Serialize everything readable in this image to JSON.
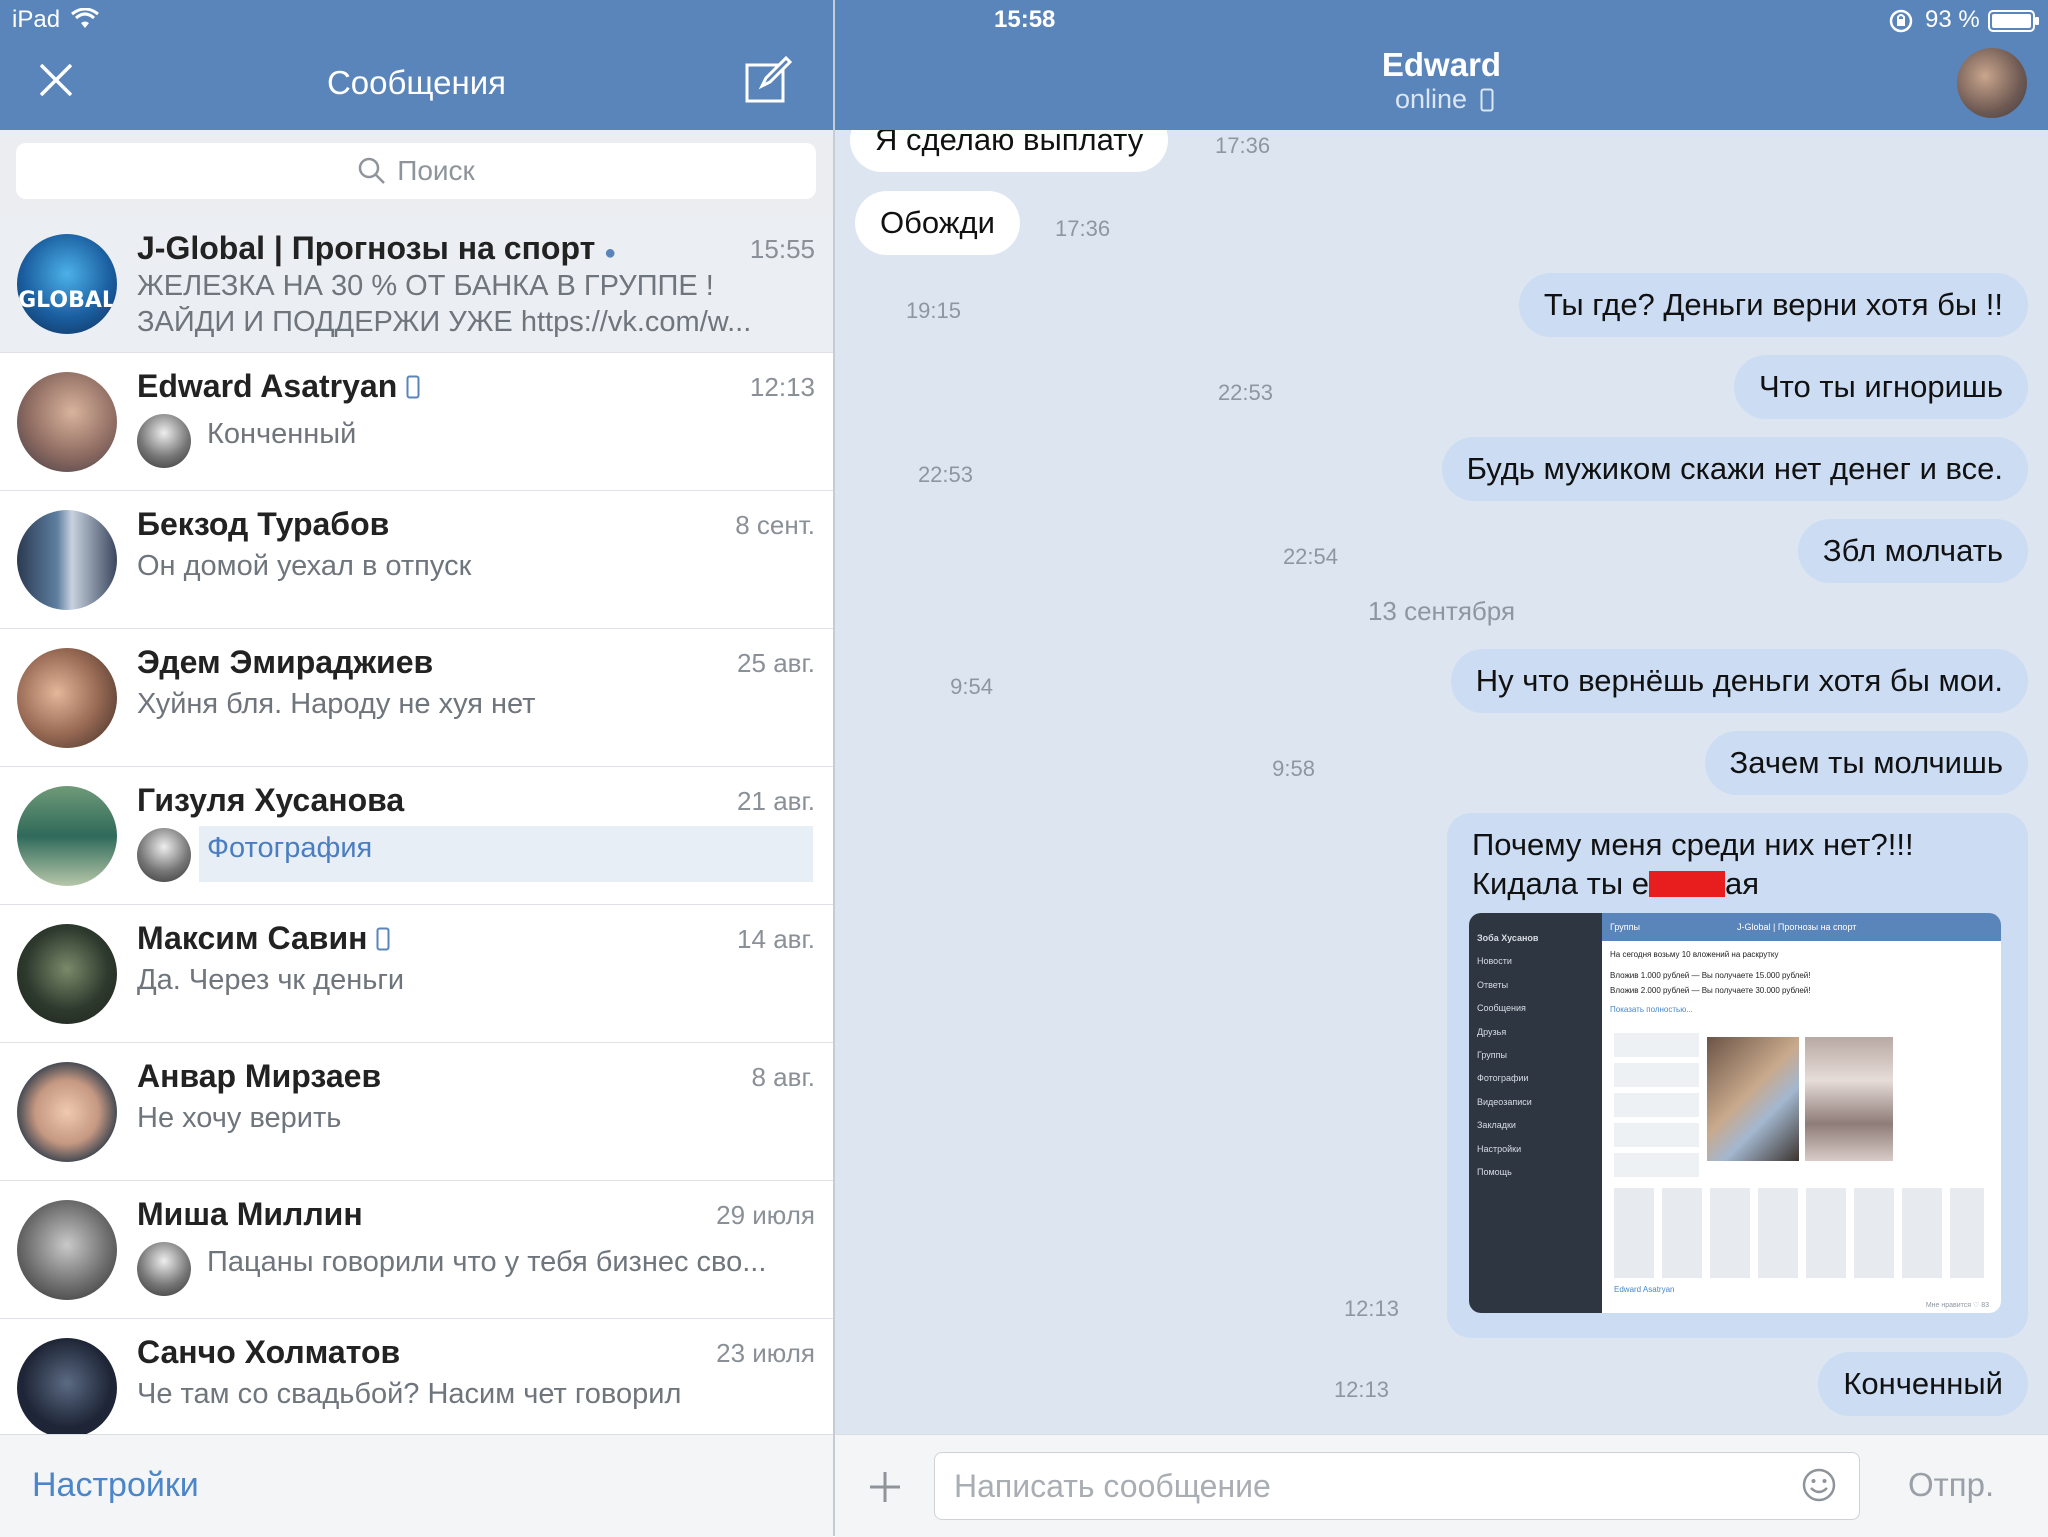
{
  "status_bar": {
    "device": "iPad",
    "time": "15:58",
    "battery": "93 %"
  },
  "left_header": {
    "title": "Сообщения",
    "close_icon": "close-icon",
    "compose_icon": "compose-icon"
  },
  "search": {
    "placeholder": "Поиск"
  },
  "conversations": [
    {
      "name": "J-Global | Прогнозы на спорт",
      "time": "15:55",
      "message": "ЖЕЛЕЗКА НА 30 % ОТ БАНКА В ГРУППЕ !",
      "message2": "ЗАЙДИ И ПОДДЕРЖИ УЖЕ https://vk.com/w...",
      "unread_dot": "●"
    },
    {
      "name": "Edward Asatryan",
      "time": "12:13",
      "message": "Конченный"
    },
    {
      "name": "Бекзод Турабов",
      "time": "8 сент.",
      "message": "Он домой уехал в отпуск"
    },
    {
      "name": "Эдем Эмираджиев",
      "time": "25 авг.",
      "message": "Хуйня бля. Народу не хуя нет"
    },
    {
      "name": "Гизуля Хусанова",
      "time": "21 авг.",
      "message": "Фотография"
    },
    {
      "name": "Максим Савин",
      "time": "14 авг.",
      "message": "Да. Через чк деньги"
    },
    {
      "name": "Анвар Мирзаев",
      "time": "8 авг.",
      "message": "Не хочу верить"
    },
    {
      "name": "Миша Миллин",
      "time": "29 июля",
      "message": "Пацаны говорили что у тебя бизнес сво..."
    },
    {
      "name": "Санчо Холматов",
      "time": "23 июля",
      "message": "Че там со свадьбой? Насим чет говорил"
    }
  ],
  "left_footer": {
    "settings_label": "Настройки"
  },
  "chat_header": {
    "name": "Edward",
    "status": "online"
  },
  "messages": [
    {
      "dir": "in",
      "text": "Я сделаю выплату",
      "time": "17:36"
    },
    {
      "dir": "in",
      "text": "Обожди",
      "time": "17:36"
    },
    {
      "dir": "out",
      "text": "Ты где? Деньги верни хотя бы !!",
      "time": "19:15"
    },
    {
      "dir": "out",
      "text": "Что ты игноришь",
      "time": "22:53"
    },
    {
      "dir": "out",
      "text": "Будь мужиком скажи нет денег и все.",
      "time": "22:53"
    },
    {
      "dir": "out",
      "text": "Збл молчать",
      "time": "22:54"
    },
    {
      "dir": "out",
      "text": "Ну что вернёшь деньги хотя бы мои.",
      "time": "9:54"
    },
    {
      "dir": "out",
      "text": "Зачем ты молчишь",
      "time": "9:58"
    },
    {
      "dir": "out",
      "text": "Почему меня среди них нет?!!!",
      "text2_a": "Кидала ты е",
      "text2_b": "ая",
      "time": "12:13"
    },
    {
      "dir": "out",
      "text": "Конченный",
      "time": "12:13"
    }
  ],
  "date_separator": "13 сентября",
  "photo": {
    "menu": [
      "Зоба Хусанов",
      "Новости",
      "Ответы",
      "Сообщения",
      "Друзья",
      "Группы",
      "Фотографии",
      "Видеозаписи",
      "Закладки",
      "Настройки",
      "Помощь"
    ],
    "back": "Группы",
    "title": "J-Global | Прогнозы на спорт",
    "post": "На сегодня возьму 10 вложений на раскрутку",
    "line1": "Вложив 1.000 рублей — Вы получаете 15.000 рублей!",
    "line2": "Вложив 2.000 рублей — Вы получаете 30.000 рублей!",
    "more": "Показать полностью...",
    "author": "Edward Asatryan",
    "likes": "Мне нравится ♡ 83"
  },
  "composer": {
    "placeholder": "Написать сообщение",
    "send_label": "Отпр."
  },
  "colors": {
    "header": "#5a85ba",
    "out_bubble": "#cbdcf3",
    "chat_bg": "#dde6f0",
    "link": "#4a86c8"
  }
}
